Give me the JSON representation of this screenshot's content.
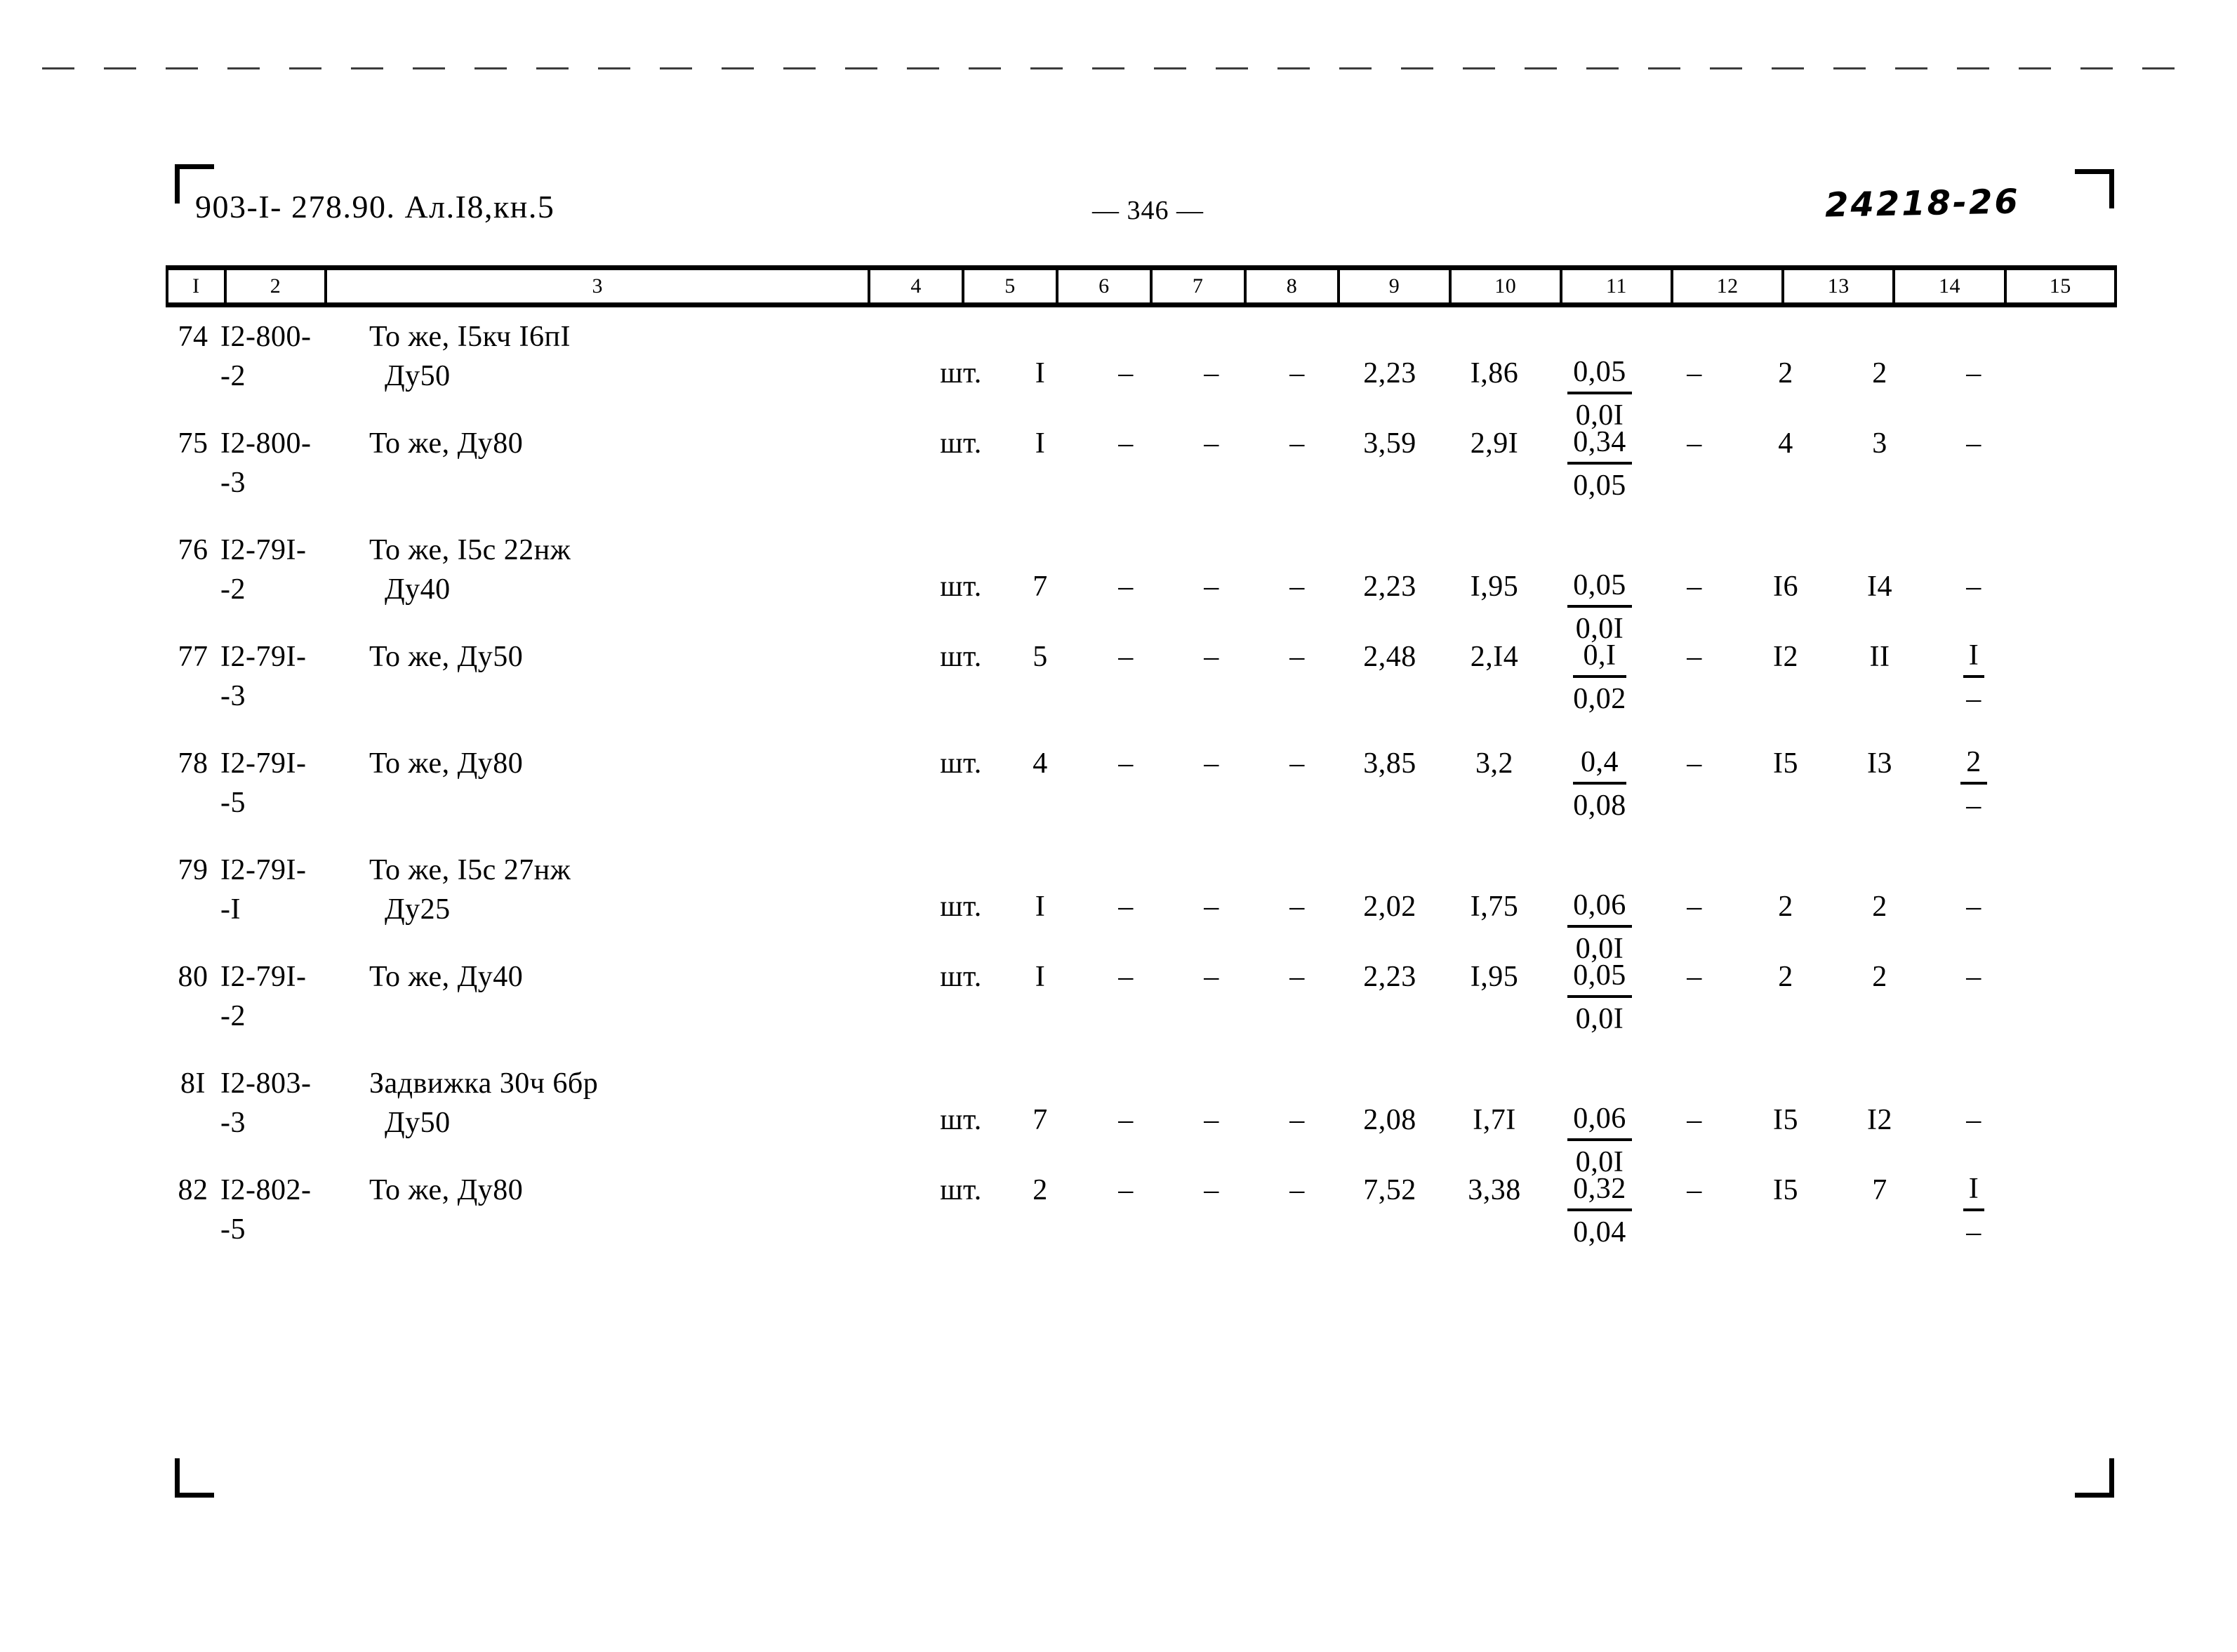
{
  "header": {
    "doc_code": "903-I- 278.90. Ал.I8,кн.5",
    "page_number": "— 346 —",
    "archive_code": "24218-26"
  },
  "table": {
    "column_headers": [
      "I",
      "2",
      "3",
      "4",
      "5",
      "6",
      "7",
      "8",
      "9",
      "10",
      "11",
      "12",
      "13",
      "14",
      "15"
    ],
    "rows": [
      {
        "c1": "74",
        "c2_line1": "I2-800-",
        "c2_line2": "-2",
        "c3_line1": "То же, I5кч I6пI",
        "c3_line2": "Ду50",
        "c4": "шт.",
        "c5": "I",
        "c6": "–",
        "c7": "–",
        "c8": "–",
        "c9": "2,23",
        "c10": "I,86",
        "c11_num": "0,05",
        "c11_den": "0,0I",
        "c12": "–",
        "c13": "2",
        "c14": "2",
        "c15": "–",
        "c15_is_fraction": false
      },
      {
        "c1": "75",
        "c2_line1": "I2-800-",
        "c2_line2": "-3",
        "c3_line1": "То же, Ду80",
        "c3_line2": "",
        "c4": "шт.",
        "c5": "I",
        "c6": "–",
        "c7": "–",
        "c8": "–",
        "c9": "3,59",
        "c10": "2,9I",
        "c11_num": "0,34",
        "c11_den": "0,05",
        "c12": "–",
        "c13": "4",
        "c14": "3",
        "c15": "–",
        "c15_is_fraction": false
      },
      {
        "c1": "76",
        "c2_line1": "I2-79I-",
        "c2_line2": "-2",
        "c3_line1": "То же, I5с 22нж",
        "c3_line2": "Ду40",
        "c4": "шт.",
        "c5": "7",
        "c6": "–",
        "c7": "–",
        "c8": "–",
        "c9": "2,23",
        "c10": "I,95",
        "c11_num": "0,05",
        "c11_den": "0,0I",
        "c12": "–",
        "c13": "I6",
        "c14": "I4",
        "c15": "–",
        "c15_is_fraction": false
      },
      {
        "c1": "77",
        "c2_line1": "I2-79I-",
        "c2_line2": "-3",
        "c3_line1": "То же, Ду50",
        "c3_line2": "",
        "c4": "шт.",
        "c5": "5",
        "c6": "–",
        "c7": "–",
        "c8": "–",
        "c9": "2,48",
        "c10": "2,I4",
        "c11_num": "0,I",
        "c11_den": "0,02",
        "c12": "–",
        "c13": "I2",
        "c14": "II",
        "c15_num": "I",
        "c15_den": "–",
        "c15_is_fraction": true
      },
      {
        "c1": "78",
        "c2_line1": "I2-79I-",
        "c2_line2": "-5",
        "c3_line1": "То же, Ду80",
        "c3_line2": "",
        "c4": "шт.",
        "c5": "4",
        "c6": "–",
        "c7": "–",
        "c8": "–",
        "c9": "3,85",
        "c10": "3,2",
        "c11_num": "0,4",
        "c11_den": "0,08",
        "c12": "–",
        "c13": "I5",
        "c14": "I3",
        "c15_num": "2",
        "c15_den": "–",
        "c15_is_fraction": true
      },
      {
        "c1": "79",
        "c2_line1": "I2-79I-",
        "c2_line2": "-I",
        "c3_line1": "То же, I5с 27нж",
        "c3_line2": "Ду25",
        "c4": "шт.",
        "c5": "I",
        "c6": "–",
        "c7": "–",
        "c8": "–",
        "c9": "2,02",
        "c10": "I,75",
        "c11_num": "0,06",
        "c11_den": "0,0I",
        "c12": "–",
        "c13": "2",
        "c14": "2",
        "c15": "–",
        "c15_is_fraction": false
      },
      {
        "c1": "80",
        "c2_line1": "I2-79I-",
        "c2_line2": "-2",
        "c3_line1": "То же, Ду40",
        "c3_line2": "",
        "c4": "шт.",
        "c5": "I",
        "c6": "–",
        "c7": "–",
        "c8": "–",
        "c9": "2,23",
        "c10": "I,95",
        "c11_num": "0,05",
        "c11_den": "0,0I",
        "c12": "–",
        "c13": "2",
        "c14": "2",
        "c15": "–",
        "c15_is_fraction": false
      },
      {
        "c1": "8I",
        "c2_line1": "I2-803-",
        "c2_line2": "-3",
        "c3_line1": "Задвижка 30ч 6бр",
        "c3_line2": "Ду50",
        "c4": "шт.",
        "c5": "7",
        "c6": "–",
        "c7": "–",
        "c8": "–",
        "c9": "2,08",
        "c10": "I,7I",
        "c11_num": "0,06",
        "c11_den": "0,0I",
        "c12": "–",
        "c13": "I5",
        "c14": "I2",
        "c15": "–",
        "c15_is_fraction": false
      },
      {
        "c1": "82",
        "c2_line1": "I2-802-",
        "c2_line2": "-5",
        "c3_line1": "То же, Ду80",
        "c3_line2": "",
        "c4": "шт.",
        "c5": "2",
        "c6": "–",
        "c7": "–",
        "c8": "–",
        "c9": "7,52",
        "c10": "3,38",
        "c11_num": "0,32",
        "c11_den": "0,04",
        "c12": "–",
        "c13": "I5",
        "c14": "7",
        "c15_num": "I",
        "c15_den": "–",
        "c15_is_fraction": true
      }
    ]
  }
}
